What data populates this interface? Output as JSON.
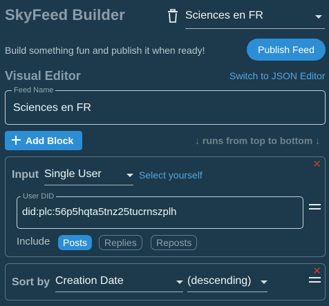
{
  "header": {
    "title": "SkyFeed Builder",
    "selected_feed": "Sciences en FR"
  },
  "toolbar": {
    "tagline": "Build something fun and publish it when ready!",
    "publish_label": "Publish Feed"
  },
  "editor": {
    "title": "Visual Editor",
    "json_link": "Switch to JSON Editor",
    "feed_name_label": "Feed Name",
    "feed_name_value": "Sciences en FR",
    "add_block_label": "Add Block",
    "order_hint": "↓ runs from top to bottom ↓"
  },
  "blocks": {
    "input": {
      "label": "Input",
      "mode": "Single User",
      "select_yourself": "Select yourself",
      "did_label": "User DID",
      "did_value": "did:plc:56p5hqta5tnz25tucrnszplh",
      "include_label": "Include",
      "chips": [
        {
          "label": "Posts",
          "active": true
        },
        {
          "label": "Replies",
          "active": false
        },
        {
          "label": "Reposts",
          "active": false
        }
      ]
    },
    "sort": {
      "label": "Sort by",
      "field": "Creation Date",
      "direction": "(descending)"
    }
  },
  "icons": {
    "delete_feed": "trash-icon",
    "add": "plus-icon",
    "remove_block": "close-icon",
    "reorder": "drag-handle-icon",
    "dropdown": "chevron-down-icon"
  },
  "colors": {
    "background": "#1c3a4b",
    "accent": "#2d8ed6",
    "link": "#52a6e6",
    "danger": "#d9362e",
    "muted_heading": "#8b9da7"
  }
}
